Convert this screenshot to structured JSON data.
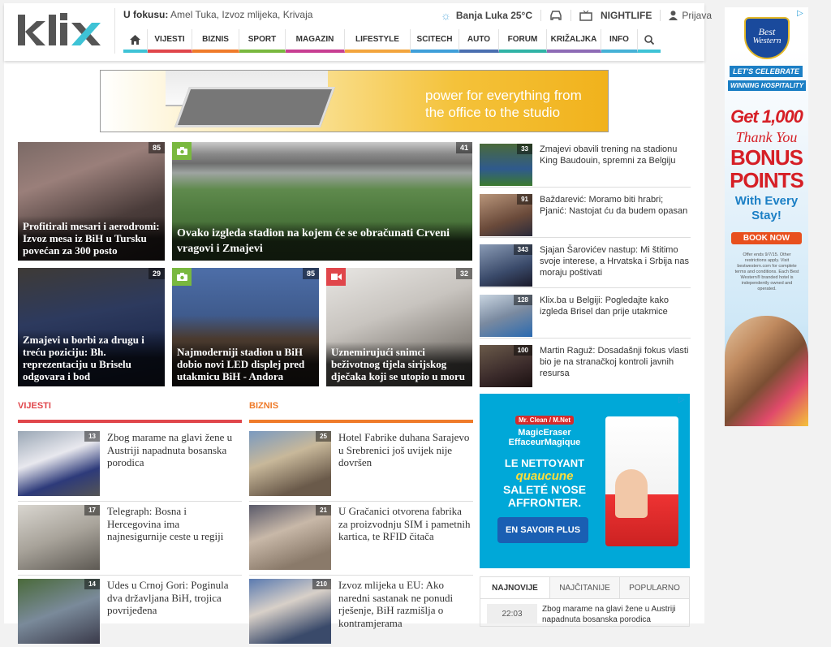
{
  "header": {
    "logo_alt": "klix",
    "focus_label": "U fokusu:",
    "focus_items": "Amel Tuka, Izvoz mlijeka, Krivaja",
    "weather": "Banja Luka 25°C",
    "nightlife": "NIGHTLIFE",
    "login": "Prijava"
  },
  "nav": {
    "items": [
      {
        "label": "VIJESTI",
        "color": "#e0464b"
      },
      {
        "label": "BIZNIS",
        "color": "#ef7b2a"
      },
      {
        "label": "SPORT",
        "color": "#79b83f"
      },
      {
        "label": "MAGAZIN",
        "color": "#c83f92"
      },
      {
        "label": "LIFESTYLE",
        "color": "#f3a53d"
      },
      {
        "label": "SCITECH",
        "color": "#3f9fd9"
      },
      {
        "label": "AUTO",
        "color": "#4a6fb0"
      },
      {
        "label": "FORUM",
        "color": "#30b3a6"
      },
      {
        "label": "KRIŽALJKA",
        "color": "#8d6bb5"
      },
      {
        "label": "INFO",
        "color": "#45b1d6"
      }
    ]
  },
  "main_ad": {
    "text": "power for everything from the office to the studio"
  },
  "top_tiles": [
    {
      "caption": "Profitirali mesari i aerodromi: Izvoz mesa iz BiH u Tursku povećan za 300 posto",
      "count": "85"
    },
    {
      "caption": "Ovako izgleda stadion na kojem će se obračunati Crveni vragovi i Zmajevi",
      "count": "41"
    },
    {
      "caption": "Zmajevi u borbi za drugu i treću poziciju: Bh. reprezentaciju u Briselu odgovara i bod",
      "count": "29"
    },
    {
      "caption": "Najmoderniji stadion u BiH dobio novi LED displej pred utakmicu BiH - Andora",
      "count": "85"
    },
    {
      "caption": "Uznemirujući snimci beživotnog tijela sirijskog dječaka koji se utopio u moru",
      "count": "32"
    }
  ],
  "side_items": [
    {
      "text": "Zmajevi obavili trening na stadionu King Baudouin, spremni za Belgiju",
      "count": "33"
    },
    {
      "text": "Baždarević: Moramo biti hrabri; Pjanić: Nastojat ću da budem opasan",
      "count": "91"
    },
    {
      "text": "Sjajan Šarovićev nastup: Mi štitimo svoje interese, a Hrvatska i Srbija nas moraju poštivati",
      "count": "343"
    },
    {
      "text": "Klix.ba u Belgiji: Pogledajte kako izgleda Brisel dan prije utakmice",
      "count": "128"
    },
    {
      "text": "Martin Raguž: Dosadašnji fokus vlasti bio je na stranačkoj kontroli javnih resursa",
      "count": "100"
    }
  ],
  "sections": {
    "vijesti": {
      "title": "VIJESTI",
      "color": "#e0464b",
      "items": [
        {
          "text": "Zbog marame na glavi žene u Austriji napadnuta bosanska porodica",
          "count": "13"
        },
        {
          "text": "Telegraph: Bosna i Hercegovina ima najnesigurnije ceste u regiji",
          "count": "17"
        },
        {
          "text": "Udes u Crnoj Gori: Poginula dva državljana BiH, trojica povrijeđena",
          "count": "14"
        }
      ]
    },
    "biznis": {
      "title": "BIZNIS",
      "color": "#ef7b2a",
      "items": [
        {
          "text": "Hotel Fabrike duhana Sarajevo u Srebrenici još uvijek nije dovršen",
          "count": "25"
        },
        {
          "text": "U Gračanici otvorena fabrika za proizvodnju SIM i pametnih kartica, te RFID čitača",
          "count": "21"
        },
        {
          "text": "Izvoz mlijeka u EU: Ako naredni sastanak ne ponudi rješenje, BiH razmišlja o kontramjerama",
          "count": "210"
        }
      ]
    }
  },
  "square_ad": {
    "brand": "Mr. Clean / M.Net",
    "product": "MagicEraser EffaceurMagique",
    "line1": "LE NETTOYANT",
    "line2": "quaucune",
    "line3": "SALETÉ N'OSE",
    "line4": "AFFRONTER.",
    "cta": "EN SAVOIR PLUS"
  },
  "tabs": {
    "items": [
      "NAJNOVIJE",
      "NAJČITANIJE",
      "POPULARNO"
    ]
  },
  "latest": {
    "time": "22:03",
    "text": "Zbog marame na glavi žene u Austriji napadnuta bosanska porodica"
  },
  "sky_ad": {
    "brand_line1": "Best",
    "brand_line2": "Western",
    "ribbon1": "LET'S CELEBRATE",
    "ribbon2": "WINNING HOSPITALITY",
    "get": "Get 1,000",
    "thank": "Thank You",
    "bonus": "BONUS",
    "points": "POINTS",
    "with": "With Every",
    "stay": "Stay!",
    "cta": "BOOK NOW",
    "fine": "Offer ends 9/7/15. Other restrictions apply. Visit bestwestern.com for complete terms and conditions. Each Best Western® branded hotel is independently owned and operated."
  }
}
